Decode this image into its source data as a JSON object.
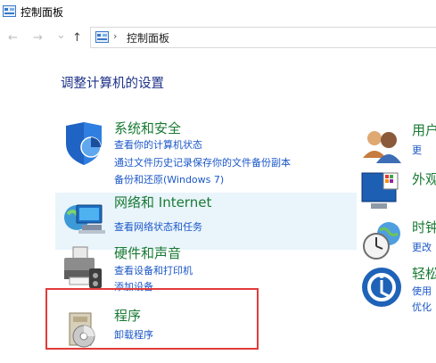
{
  "window": {
    "title": "控制面板"
  },
  "nav": {
    "back": "←",
    "forward": "→",
    "dropdown": "⌄",
    "up": "↑"
  },
  "address": {
    "separator": "›",
    "path": "控制面板"
  },
  "heading": "调整计算机的设置",
  "categories": [
    {
      "title": "系统和安全",
      "links": [
        "查看你的计算机状态",
        "通过文件历史记录保存你的文件备份副本",
        "备份和还原(Windows 7)"
      ]
    },
    {
      "title": "网络和 Internet",
      "links": [
        "查看网络状态和任务"
      ]
    },
    {
      "title": "硬件和声音",
      "links": [
        "查看设备和打印机",
        "添加设备"
      ]
    },
    {
      "title": "程序",
      "links": [
        "卸载程序"
      ]
    }
  ],
  "right_categories": [
    {
      "title": "用户",
      "links": [
        "更"
      ]
    },
    {
      "title": "外观",
      "links": []
    },
    {
      "title": "时钟",
      "links": [
        "更改"
      ]
    },
    {
      "title": "轻松",
      "links": [
        "使用",
        "优化"
      ]
    }
  ],
  "colors": {
    "category_title": "#197a34",
    "link": "#1a57c8",
    "heading": "#1e3287",
    "highlight": "#e9f4fb",
    "annotation_box": "#e23b3b"
  }
}
